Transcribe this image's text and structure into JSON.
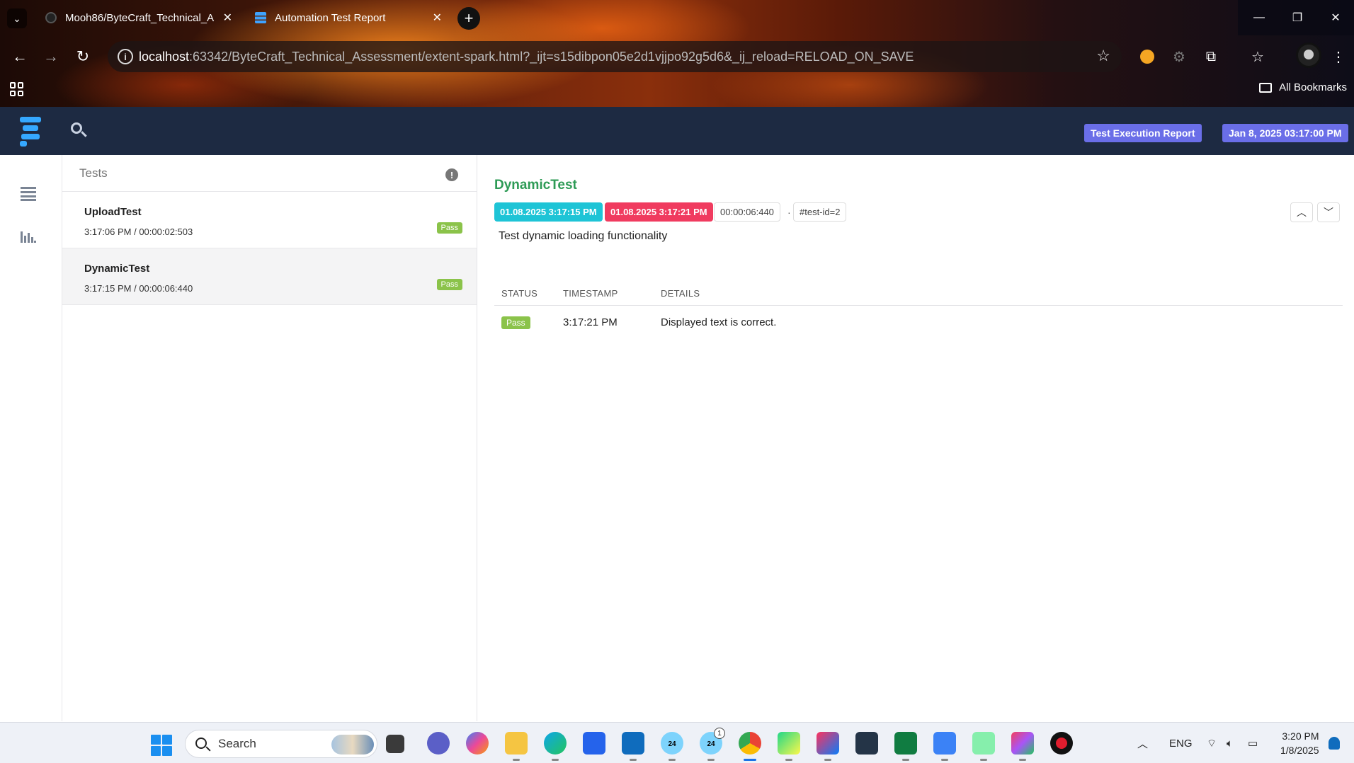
{
  "browser": {
    "tabs": [
      {
        "title": "Mooh86/ByteCraft_Technical_A",
        "active": false
      },
      {
        "title": "Automation Test Report",
        "active": true
      }
    ],
    "url_host": "localhost",
    "url_rest": ":63342/ByteCraft_Technical_Assessment/extent-spark.html?_ijt=s15dibpon05e2d1vjjpo92g5d6&_ij_reload=RELOAD_ON_SAVE",
    "bookmarks_label": "All Bookmarks"
  },
  "header": {
    "report_badge": "Test Execution Report",
    "date_badge": "Jan 8, 2025 03:17:00 PM",
    "bg_color": "#1d2a42",
    "badge_color": "#6a6ee8"
  },
  "tests_panel": {
    "title": "Tests",
    "items": [
      {
        "name": "UploadTest",
        "meta": "3:17:06 PM / 00:00:02:503",
        "status": "Pass"
      },
      {
        "name": "DynamicTest",
        "meta": "3:17:15 PM / 00:00:06:440",
        "status": "Pass",
        "selected": true
      }
    ]
  },
  "detail": {
    "title": "DynamicTest",
    "start": "01.08.2025 3:17:15 PM",
    "end": "01.08.2025 3:17:21 PM",
    "duration": "00:00:06:440",
    "separator": "·",
    "test_id": "#test-id=2",
    "description": "Test dynamic loading functionality",
    "columns": [
      "STATUS",
      "TIMESTAMP",
      "DETAILS"
    ],
    "logs": [
      {
        "status": "Pass",
        "timestamp": "3:17:21 PM",
        "details": "Displayed text is correct."
      }
    ],
    "title_color": "#2e9b56",
    "pass_color": "#8bc34a",
    "start_color": "#1ec4d6",
    "end_color": "#f03b5f"
  },
  "taskbar": {
    "search_label": "Search",
    "language": "ENG",
    "time": "3:20 PM",
    "date": "1/8/2025",
    "calendar_num": "24",
    "calendar_num2": "24",
    "badge_count": "1"
  }
}
